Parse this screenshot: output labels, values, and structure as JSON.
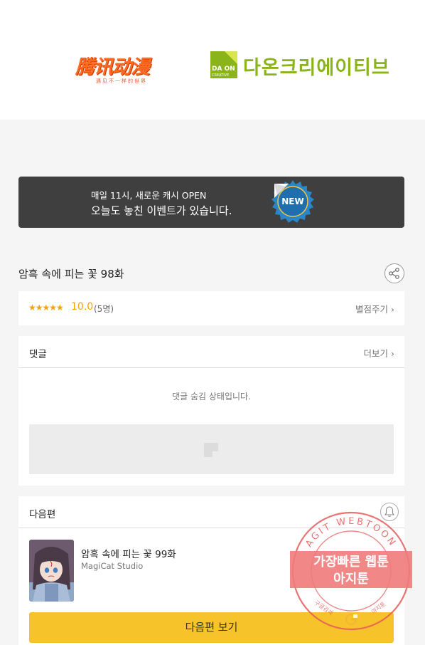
{
  "partners": {
    "cut_text": "...........................................",
    "tencent": {
      "name": "腾讯动漫",
      "tagline": "遇见不一样的世界"
    },
    "daon": {
      "box_text": "DA ON",
      "box_sub": "CREATIVE",
      "name": "다온크리에이티브"
    }
  },
  "banner": {
    "line1": "매일 11시, 새로운 캐시 OPEN",
    "line2": "오늘도 놓친 이벤트가 있습니다.",
    "badge": "NEW"
  },
  "episode": {
    "title": "암흑 속에 피는 꽃 98화"
  },
  "rating": {
    "stars": "★★★★★",
    "score": "10.0",
    "count": "(5명)",
    "rate_label": "별점주기",
    "rate_chevron": "›"
  },
  "comments": {
    "label": "댓글",
    "more_label": "더보기",
    "more_chevron": "›",
    "hidden_message": "댓글 숨김 상태입니다."
  },
  "next": {
    "label": "다음편",
    "title": "암흑 속에 피는 꽃 99화",
    "studio": "MagiCat Studio",
    "button": "다음편 보기"
  },
  "stamp": {
    "ring_text": "AGIT WEBTOON",
    "line1": "가장빠른 웹툰",
    "line2": "아지툰",
    "bottom_left": "구글검색",
    "bottom_right": "아지툰"
  }
}
